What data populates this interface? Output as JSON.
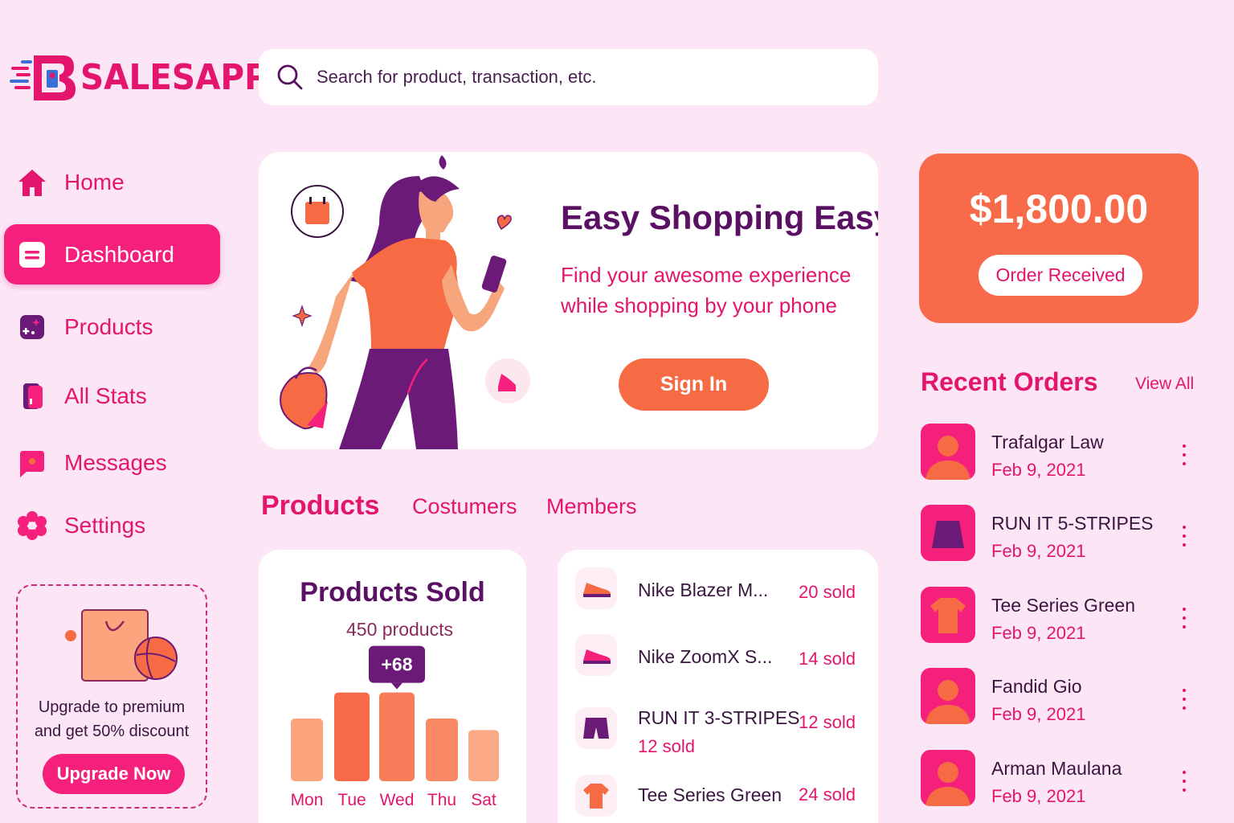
{
  "app": {
    "name": "SALESAPP"
  },
  "search": {
    "placeholder": "Search for product, transaction, etc."
  },
  "sidebar": {
    "items": [
      {
        "label": "Home",
        "icon": "home-icon"
      },
      {
        "label": "Dashboard",
        "icon": "dashboard-icon",
        "active": true
      },
      {
        "label": "Products",
        "icon": "products-icon"
      },
      {
        "label": "All Stats",
        "icon": "stats-icon"
      },
      {
        "label": "Messages",
        "icon": "messages-icon"
      },
      {
        "label": "Settings",
        "icon": "settings-icon"
      }
    ],
    "promo": {
      "line1": "Upgrade to premium",
      "line2": "and get 50% discount",
      "button": "Upgrade Now"
    }
  },
  "hero": {
    "title": "Easy Shopping Easy",
    "subtitle": "Find your awesome experience while shopping by your phone",
    "button": "Sign In"
  },
  "tabs": [
    {
      "label": "Products",
      "active": true
    },
    {
      "label": "Costumers"
    },
    {
      "label": "Members"
    }
  ],
  "products_sold": {
    "title": "Products Sold",
    "subtitle": "450 products",
    "highlight": "+68"
  },
  "chart_data": {
    "type": "bar",
    "categories": [
      "Mon",
      "Tue",
      "Wed",
      "Thu",
      "Sat"
    ],
    "values": [
      65,
      92,
      92,
      65,
      53
    ],
    "highlight_index": 2,
    "highlight_label": "+68",
    "colors": [
      "#fba47e",
      "#f76b4a",
      "#f77d5a",
      "#f98a65",
      "#fbaa85"
    ]
  },
  "product_list": [
    {
      "name": "Nike Blazer M...",
      "count": "20 sold",
      "icon": "sneaker-icon"
    },
    {
      "name": "Nike ZoomX S...",
      "count": "14 sold",
      "icon": "sneaker-icon"
    },
    {
      "name": "RUN IT 3-STRIPES",
      "sub": "12 sold",
      "count": "12 sold",
      "icon": "shorts-icon"
    },
    {
      "name": "Tee Series Green",
      "count": "24 sold",
      "icon": "tshirt-icon"
    }
  ],
  "revenue": {
    "amount": "$1,800.00",
    "button": "Order Received"
  },
  "recent_orders": {
    "title": "Recent Orders",
    "view_all": "View All",
    "items": [
      {
        "name": "Trafalgar Law",
        "date": "Feb 9, 2021",
        "icon": "user-avatar"
      },
      {
        "name": "RUN IT 5-STRIPES",
        "date": "Feb 9, 2021",
        "icon": "shorts-icon"
      },
      {
        "name": "Tee Series Green",
        "date": "Feb 9, 2021",
        "icon": "tshirt-icon"
      },
      {
        "name": "Fandid Gio",
        "date": "Feb 9, 2021",
        "icon": "user-avatar"
      },
      {
        "name": "Arman Maulana",
        "date": "Feb 9, 2021",
        "icon": "user-avatar"
      }
    ]
  }
}
